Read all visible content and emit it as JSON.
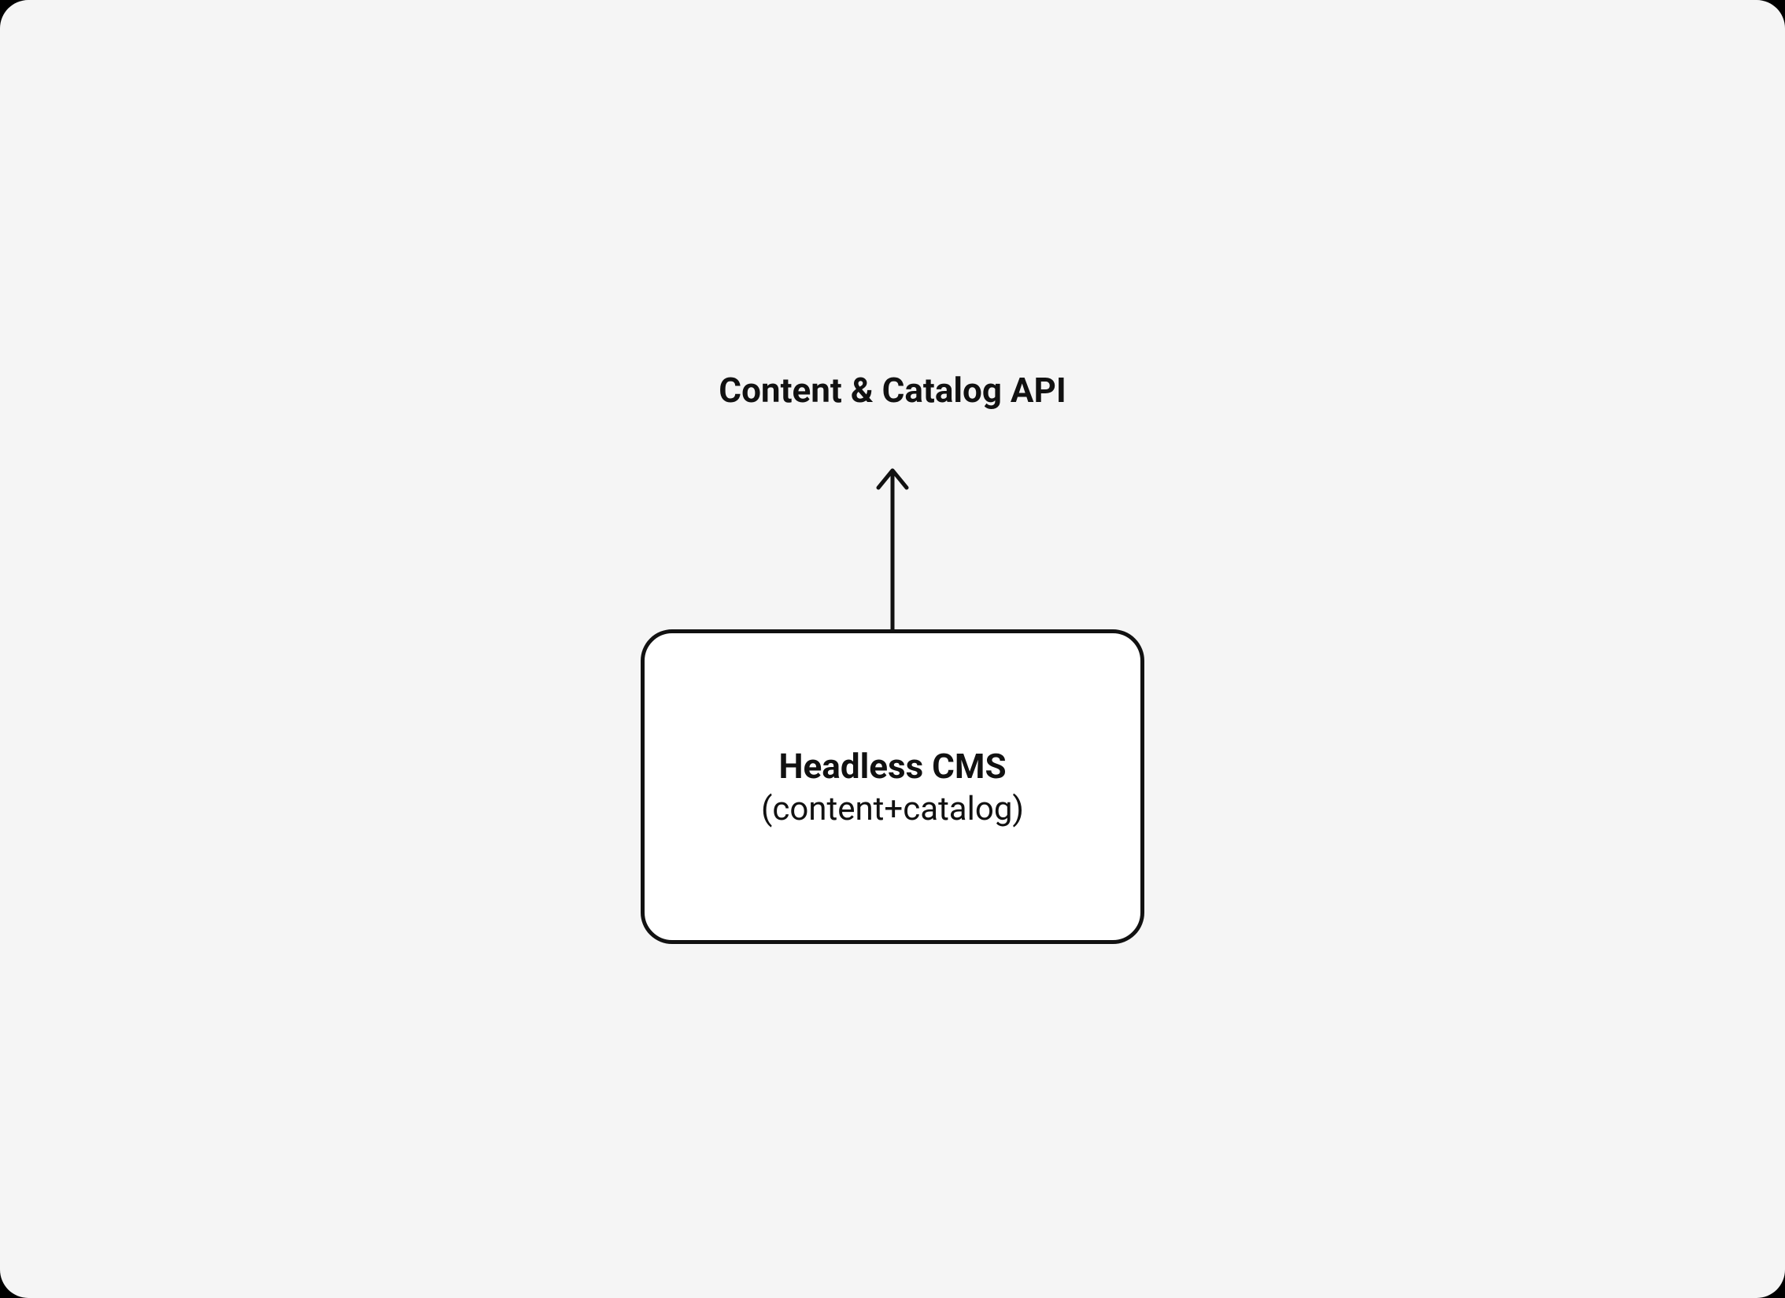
{
  "diagram": {
    "api_label": "Content & Catalog API",
    "box": {
      "title": "Headless CMS",
      "subtitle": "(content+catalog)"
    }
  }
}
